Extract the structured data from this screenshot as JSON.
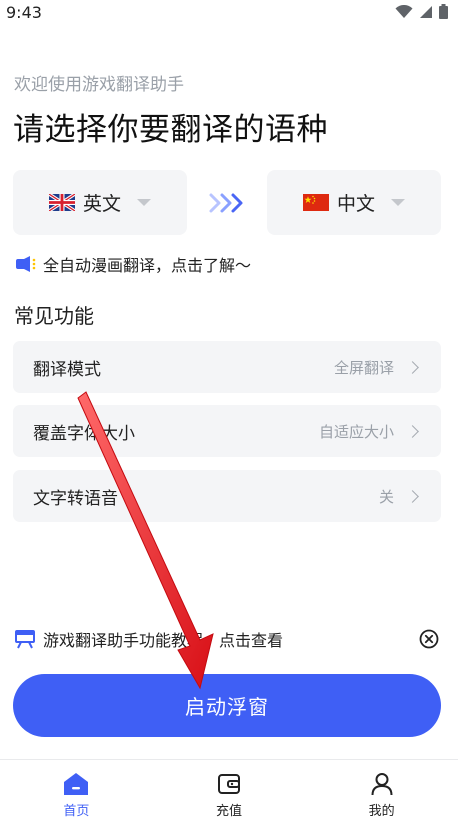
{
  "status_bar": {
    "time": "9:43"
  },
  "header": {
    "subtitle": "欢迎使用游戏翻译助手",
    "title": "请选择你要翻译的语种"
  },
  "language_select": {
    "source": {
      "label": "英文",
      "flag": "uk-flag-icon"
    },
    "target": {
      "label": "中文",
      "flag": "china-flag-icon"
    },
    "swap_icon": "triple-chevron-right-icon"
  },
  "promo": {
    "text": "全自动漫画翻译，点击了解～"
  },
  "common_functions": {
    "title": "常见功能",
    "items": [
      {
        "label": "翻译模式",
        "value": "全屏翻译"
      },
      {
        "label": "覆盖字体大小",
        "value": "自适应大小"
      },
      {
        "label": "文字转语音",
        "value": "关"
      }
    ]
  },
  "tutorial": {
    "text": "游戏翻译助手功能教程，点击查看"
  },
  "cta": {
    "label": "启动浮窗"
  },
  "tabbar": {
    "tabs": [
      {
        "label": "首页",
        "icon": "home-icon",
        "active": true
      },
      {
        "label": "充值",
        "icon": "wallet-icon",
        "active": false
      },
      {
        "label": "我的",
        "icon": "user-icon",
        "active": false
      }
    ]
  },
  "colors": {
    "accent": "#3f5ff5",
    "annotation_arrow": "#e8121b",
    "card_background": "#f4f5f7"
  }
}
